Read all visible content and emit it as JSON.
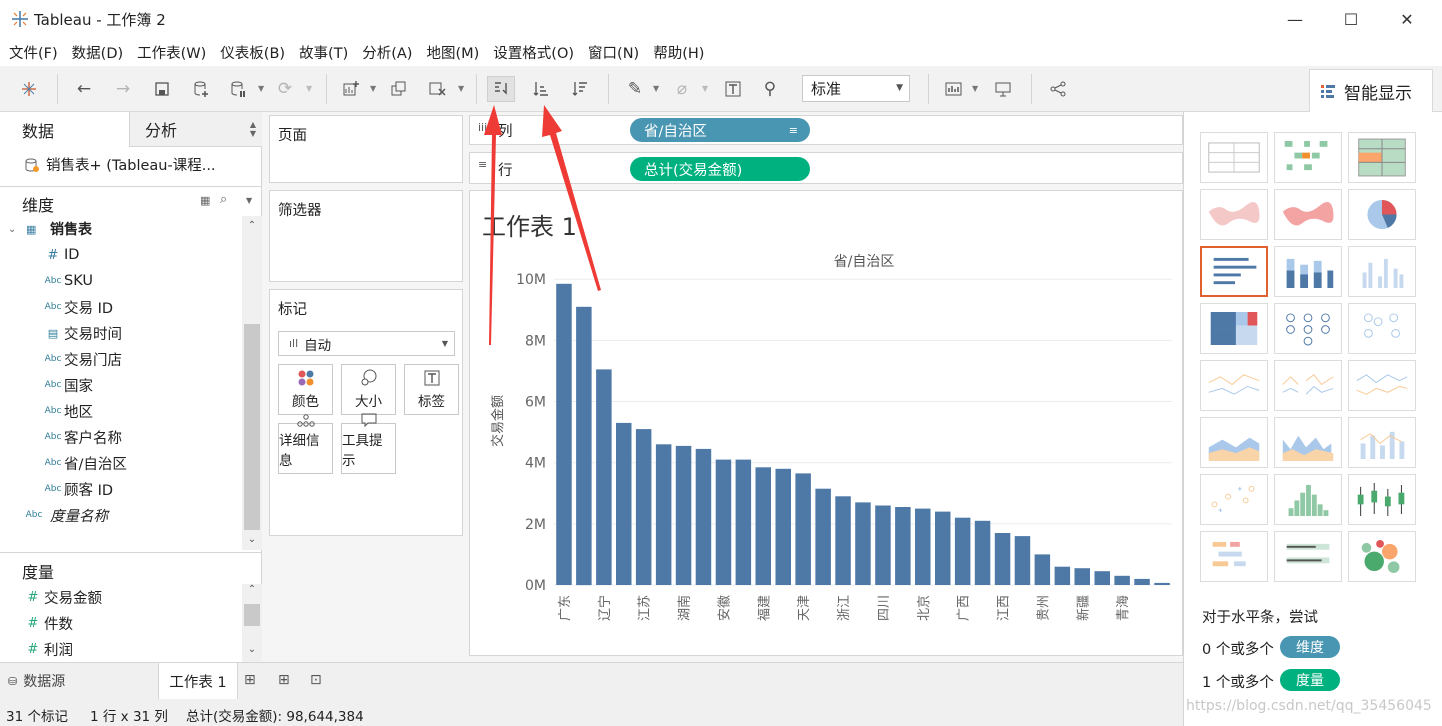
{
  "window": {
    "title": "Tableau - 工作簿 2",
    "minimize": "—",
    "maximize": "☐",
    "close": "✕"
  },
  "menu": [
    "文件(F)",
    "数据(D)",
    "工作表(W)",
    "仪表板(B)",
    "故事(T)",
    "分析(A)",
    "地图(M)",
    "设置格式(O)",
    "窗口(N)",
    "帮助(H)"
  ],
  "toolbar": {
    "fit_select": "标准",
    "smart_display_tab": "智能显示"
  },
  "left_panel": {
    "tabs": [
      "数据",
      "分析"
    ],
    "datasource": "销售表+ (Tableau-课程...",
    "dimensions_header": "维度",
    "table_name": "销售表",
    "dimensions": [
      {
        "type": "#",
        "name": "ID"
      },
      {
        "type": "Abc",
        "name": "SKU"
      },
      {
        "type": "Abc",
        "name": "交易 ID"
      },
      {
        "type": "cal",
        "name": "交易时间"
      },
      {
        "type": "Abc",
        "name": "交易门店"
      },
      {
        "type": "Abc",
        "name": "国家"
      },
      {
        "type": "Abc",
        "name": "地区"
      },
      {
        "type": "Abc",
        "name": "客户名称"
      },
      {
        "type": "Abc",
        "name": "省/自治区"
      },
      {
        "type": "Abc",
        "name": "顾客 ID"
      }
    ],
    "measure_names_label": "度量名称",
    "measures_header": "度量",
    "measures": [
      "交易金额",
      "件数",
      "利润"
    ]
  },
  "shelves": {
    "pages": "页面",
    "filters": "筛选器",
    "marks": "标记",
    "mark_type": "自动",
    "mark_buttons": [
      "颜色",
      "大小",
      "标签",
      "详细信息",
      "工具提示"
    ],
    "columns_label": "列",
    "rows_label": "行",
    "columns_pill": "省/自治区",
    "rows_pill": "总计(交易金额)"
  },
  "sheet": {
    "title": "工作表 1"
  },
  "chart_data": {
    "type": "bar",
    "title": "",
    "xlabel": "省/自治区",
    "ylabel": "交易金额",
    "ylim": [
      0,
      10400000
    ],
    "y_ticks": [
      {
        "value": 0,
        "label": "0M"
      },
      {
        "value": 2000000,
        "label": "2M"
      },
      {
        "value": 4000000,
        "label": "4M"
      },
      {
        "value": 6000000,
        "label": "6M"
      },
      {
        "value": 8000000,
        "label": "8M"
      },
      {
        "value": 10000000,
        "label": "10M"
      }
    ],
    "categories": [
      "广东",
      "",
      "辽宁",
      "",
      "江苏",
      "",
      "湖南",
      "",
      "安徽",
      "",
      "福建",
      "",
      "天津",
      "",
      "浙江",
      "",
      "四川",
      "",
      "北京",
      "",
      "广西",
      "",
      "江西",
      "",
      "贵州",
      "",
      "新疆",
      "",
      "青海",
      "",
      ""
    ],
    "values": [
      9850000,
      9100000,
      7050000,
      5300000,
      5100000,
      4600000,
      4550000,
      4450000,
      4100000,
      4100000,
      3850000,
      3800000,
      3650000,
      3150000,
      2900000,
      2700000,
      2600000,
      2550000,
      2500000,
      2400000,
      2200000,
      2100000,
      1700000,
      1600000,
      1000000,
      600000,
      550000,
      450000,
      300000,
      200000,
      70000
    ],
    "bar_color": "#4e79a7",
    "grid": true
  },
  "smart_display": {
    "hint": "对于水平条，尝试",
    "row1_prefix": "0 个或多个",
    "row1_chip": "维度",
    "row2_prefix": "1 个或多个",
    "row2_chip": "度量",
    "dim_color": "#4996b2",
    "measure_color": "#00b180"
  },
  "bottom_tabs": {
    "datasource": "数据源",
    "sheet": "工作表 1"
  },
  "status": {
    "marks": "31 个标记",
    "grid": "1 行 x 31 列",
    "sum": "总计(交易金额): 98,644,384"
  },
  "watermark": "https://blog.csdn.net/qq_35456045",
  "colors": {
    "accent_orange": "#e0612f",
    "arrow_red": "#ee3b35"
  }
}
